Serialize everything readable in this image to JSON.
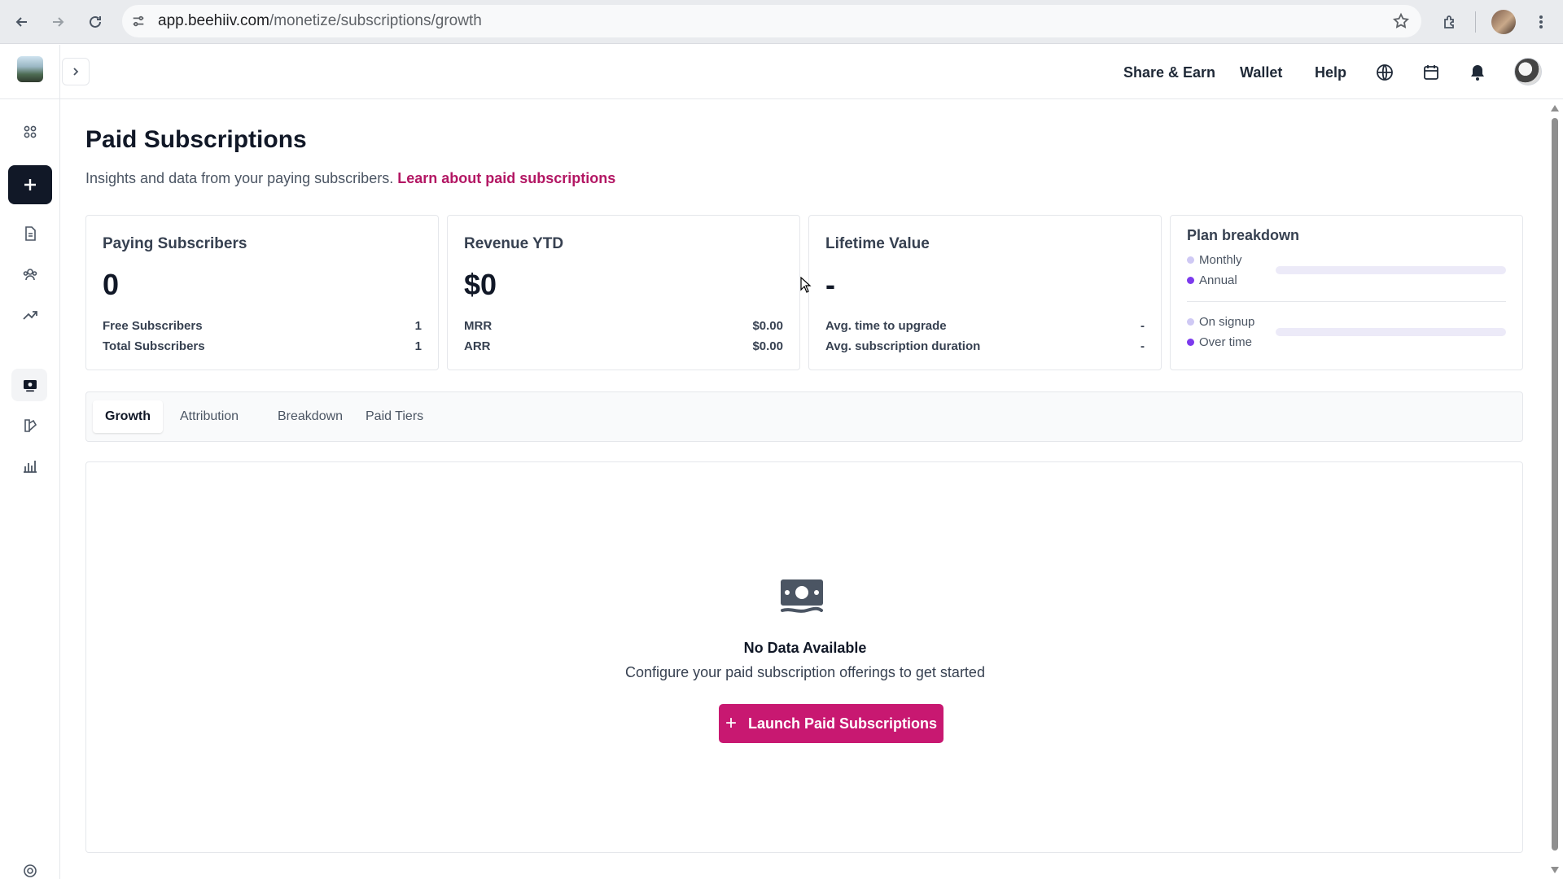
{
  "browser": {
    "url_host": "app.beehiiv.com",
    "url_path": "/monetize/subscriptions/growth"
  },
  "sidebar": {
    "items": [
      {
        "icon": "dashboard-icon"
      },
      {
        "icon": "plus-icon"
      },
      {
        "icon": "document-icon"
      },
      {
        "icon": "audience-icon"
      },
      {
        "icon": "growth-icon"
      },
      {
        "icon": "monetize-icon"
      },
      {
        "icon": "design-icon"
      },
      {
        "icon": "analytics-icon"
      },
      {
        "icon": "settings-icon"
      }
    ]
  },
  "topbar": {
    "share_earn": "Share & Earn",
    "wallet": "Wallet",
    "help": "Help"
  },
  "page": {
    "title": "Paid Subscriptions",
    "subtitle": "Insights and data from your paying subscribers.",
    "learn_link": "Learn about paid subscriptions"
  },
  "cards": {
    "paying": {
      "label": "Paying Subscribers",
      "value": "0",
      "rows": [
        {
          "label": "Free Subscribers",
          "value": "1"
        },
        {
          "label": "Total Subscribers",
          "value": "1"
        }
      ]
    },
    "revenue": {
      "label": "Revenue YTD",
      "value": "$0",
      "rows": [
        {
          "label": "MRR",
          "value": "$0.00"
        },
        {
          "label": "ARR",
          "value": "$0.00"
        }
      ]
    },
    "lifetime": {
      "label": "Lifetime Value",
      "value": "-",
      "rows": [
        {
          "label": "Avg. time to upgrade",
          "value": "-"
        },
        {
          "label": "Avg. subscription duration",
          "value": "-"
        }
      ]
    },
    "plan": {
      "label": "Plan breakdown",
      "items": [
        "Monthly",
        "Annual",
        "On signup",
        "Over time"
      ],
      "colors": {
        "light": "#cfc9f4",
        "dark": "#7c3aed"
      }
    }
  },
  "tabs": [
    "Growth",
    "Attribution",
    "Breakdown",
    "Paid Tiers"
  ],
  "active_tab": "Growth",
  "empty_state": {
    "icon": "money-icon",
    "title": "No Data Available",
    "description": "Configure your paid subscription offerings to get started",
    "button_label": "Launch Paid Subscriptions"
  },
  "colors": {
    "accent": "#c81871",
    "link": "#b31764"
  }
}
